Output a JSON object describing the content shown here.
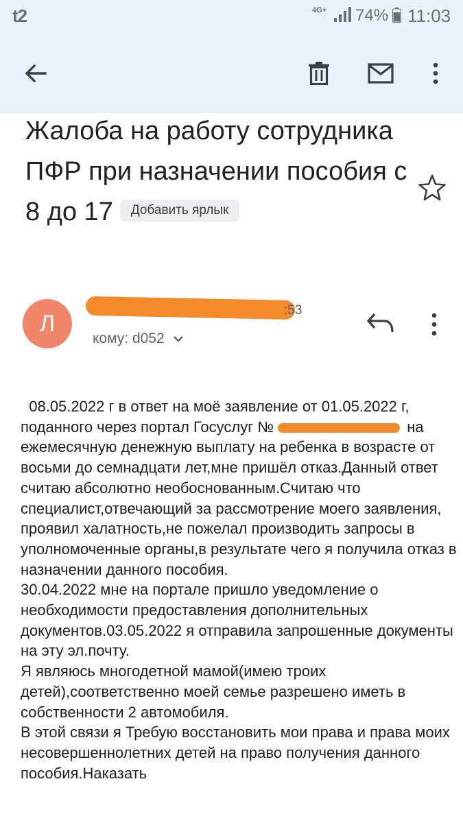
{
  "status_bar": {
    "carrier": "t2",
    "network": "4G+",
    "battery": "74%",
    "time": "11:03"
  },
  "toolbar": {
    "back_icon": "arrow-left-icon",
    "delete_icon": "trash-icon",
    "mark_unread_icon": "envelope-icon",
    "more_icon": "more-vert-icon"
  },
  "email": {
    "subject": "Жалоба на работу сотрудника ПФР при назначении пособия с 8 до 17",
    "add_label": "Добавить ярлык",
    "star_icon": "star-outline-icon",
    "sender": {
      "avatar_letter": "Л",
      "avatar_color": "#f0856a",
      "time_suffix": ":53",
      "to": "кому: d052",
      "reply_icon": "reply-icon"
    },
    "body": {
      "p1_before": "  08.05.2022 г в ответ на моё заявление от 01.05.2022 г, поданного через портал Госуслуг № ",
      "p1_after": " на ежемесячную денежную выплату на ребенка в возрасте от восьми до семнадцати лет,мне пришёл отказ.Данный ответ считаю абсолютно необоснованным.Считаю что специалист,отвечающий за рассмотрение моего заявления, проявил халатность,не пожелал производить запросы в уполномоченные органы,в результате чего я получила отказ в назначении данного пособия.",
      "p2": "30.04.2022 мне на портале пришло уведомление о необходимости предоставления дополнительных документов.03.05.2022 я отправила запрошенные документы на эту эл.почту.",
      "p3": "Я являюсь многодетной мамой(имею троих детей),соответственно моей семье разрешено иметь в собственности 2 автомобиля.",
      "p4": "В этой связи я Требую восстановить мои права и права моих несовершеннолетних детей на право получения данного пособия.Наказать"
    }
  },
  "colors": {
    "header_bg": "#eaf1fb",
    "redaction": "#f58a2b",
    "chip_bg": "#eceef1"
  }
}
